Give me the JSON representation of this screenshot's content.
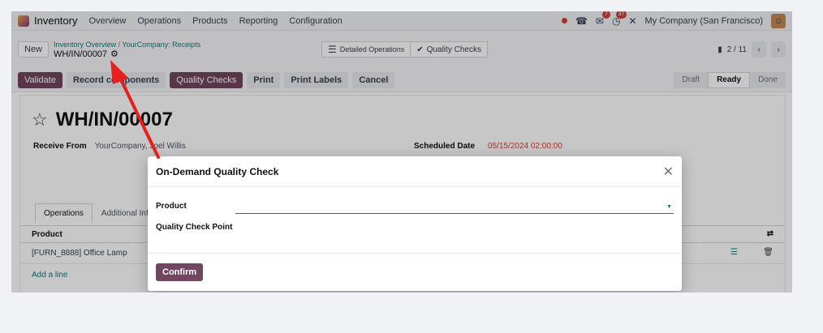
{
  "navbar": {
    "app_name": "Inventory",
    "menus": [
      "Overview",
      "Operations",
      "Products",
      "Reporting",
      "Configuration"
    ],
    "company": "My Company (San Francisco)",
    "messages_badge": "7",
    "activities_badge": "37"
  },
  "control_panel": {
    "new_label": "New",
    "breadcrumb_parent": "Inventory Overview",
    "breadcrumb_sep": "/",
    "breadcrumb_current": "YourCompany: Receipts",
    "record_ref": "WH/IN/00007",
    "detailed_ops_label": "Detailed Operations",
    "quality_checks_label": "Quality Checks",
    "pager_value": "2 / 11"
  },
  "status_bar": {
    "buttons": [
      "Validate",
      "Record components",
      "Quality Checks",
      "Print",
      "Print Labels",
      "Cancel"
    ],
    "states": [
      "Draft",
      "Ready",
      "Done"
    ],
    "active_state": "Ready"
  },
  "sheet": {
    "title": "WH/IN/00007",
    "receive_from_label": "Receive From",
    "receive_from_value": "YourCompany, Joel Willis",
    "scheduled_label": "Scheduled Date",
    "scheduled_value": "05/15/2024 02:00:00",
    "tabs": [
      "Operations",
      "Additional Info"
    ],
    "col_product": "Product",
    "row_product": "[FURN_8888] Office Lamp",
    "add_line": "Add a line"
  },
  "modal": {
    "title": "On-Demand Quality Check",
    "product_label": "Product",
    "product_value": "",
    "check_point_label": "Quality Check Point",
    "confirm_label": "Confirm"
  },
  "colors": {
    "primary": "#71465e",
    "link": "#017e84",
    "danger": "#d23f3a"
  }
}
